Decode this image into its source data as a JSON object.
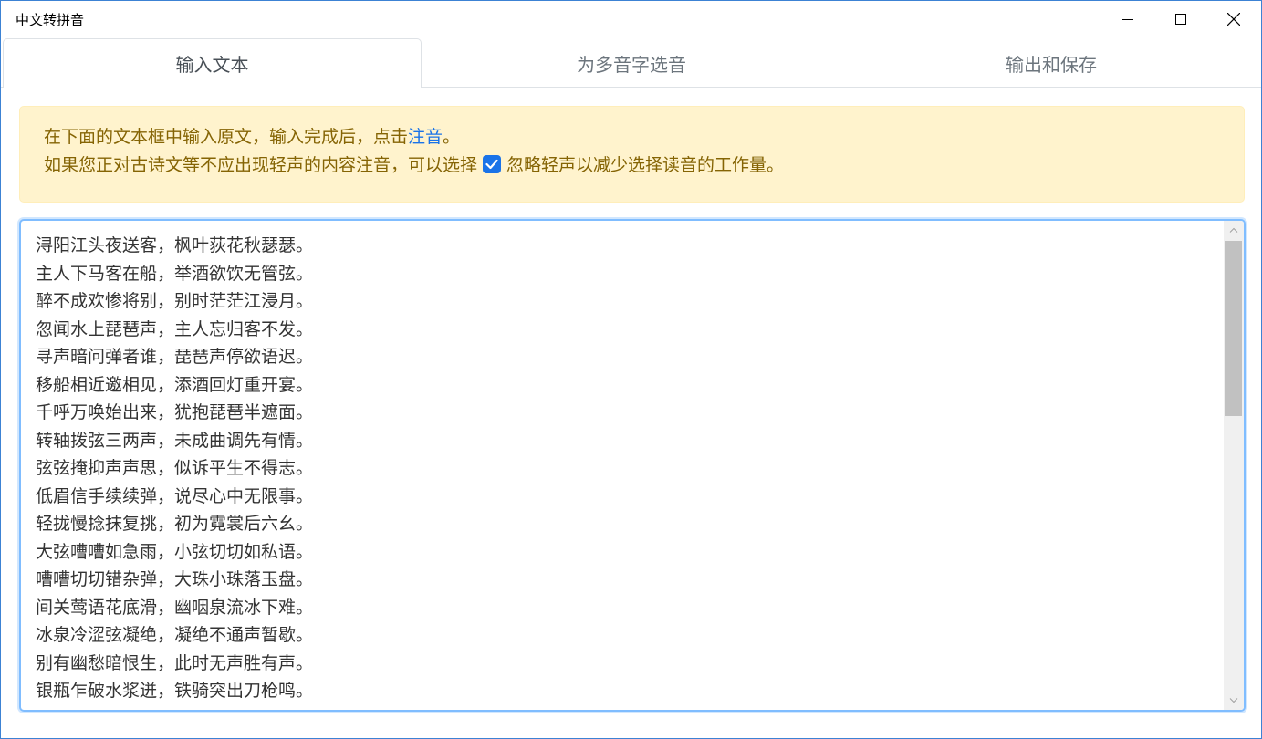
{
  "window": {
    "title": "中文转拼音"
  },
  "tabs": [
    {
      "label": "输入文本",
      "active": true
    },
    {
      "label": "为多音字选音",
      "active": false
    },
    {
      "label": "输出和保存",
      "active": false
    }
  ],
  "alert": {
    "line1_prefix": "在下面的文本框中输入原文，输入完成后，点击",
    "line1_link": "注音",
    "line1_suffix": "。",
    "line2_prefix": "如果您正对古诗文等不应出现轻声的内容注音，可以选择",
    "checkbox_checked": true,
    "line2_suffix": "忽略轻声以减少选择读音的工作量。"
  },
  "editor": {
    "text": "浔阳江头夜送客，枫叶荻花秋瑟瑟。\n主人下马客在船，举酒欲饮无管弦。\n醉不成欢惨将别，别时茫茫江浸月。\n忽闻水上琵琶声，主人忘归客不发。\n寻声暗问弹者谁，琵琶声停欲语迟。\n移船相近邀相见，添酒回灯重开宴。\n千呼万唤始出来，犹抱琵琶半遮面。\n转轴拨弦三两声，未成曲调先有情。\n弦弦掩抑声声思，似诉平生不得志。\n低眉信手续续弹，说尽心中无限事。\n轻拢慢捻抹复挑，初为霓裳后六幺。\n大弦嘈嘈如急雨，小弦切切如私语。\n嘈嘈切切错杂弹，大珠小珠落玉盘。\n间关莺语花底滑，幽咽泉流冰下难。\n冰泉冷涩弦凝绝，凝绝不通声暂歇。\n别有幽愁暗恨生，此时无声胜有声。\n银瓶乍破水浆迸，铁骑突出刀枪鸣。"
  },
  "colors": {
    "accent": "#1a73e8",
    "alert_bg": "#fff3cd",
    "alert_text": "#856404",
    "focus_border": "#80bdff"
  }
}
